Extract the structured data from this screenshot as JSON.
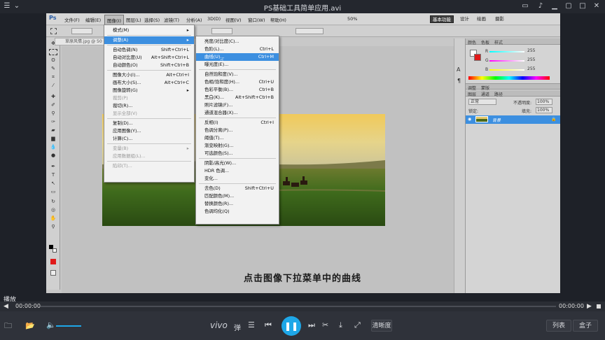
{
  "player": {
    "title": "PS基础工具简单应用.avi",
    "status_label": "播放",
    "time_current": "00:00:00",
    "time_total": "00:00:00",
    "brand": "vivo",
    "brand_suffix": "弹",
    "quality_label": "清晰度",
    "list_button": "列表",
    "box_button": "盒子",
    "volume_level": 0.6
  },
  "ps": {
    "menus": [
      "文件(F)",
      "编辑(E)",
      "图像(I)",
      "图层(L)",
      "选择(S)",
      "滤镜(T)",
      "分析(A)",
      "3D(D)",
      "视图(V)",
      "窗口(W)",
      "帮助(H)"
    ],
    "zoom": "50%",
    "workspace_tabs": [
      "基本功能",
      "设计",
      "绘画",
      "摄影"
    ],
    "doc_tab": "草原风情.jpg @ 50",
    "image_menu": [
      {
        "label": "模式(M)",
        "shortcut": "",
        "arrow": true
      },
      {
        "sep": true
      },
      {
        "label": "调整(A)",
        "shortcut": "",
        "arrow": true,
        "highlight": true
      },
      {
        "sep": true
      },
      {
        "label": "自动色调(N)",
        "shortcut": "Shift+Ctrl+L"
      },
      {
        "label": "自动对比度(U)",
        "shortcut": "Alt+Shift+Ctrl+L"
      },
      {
        "label": "自动颜色(O)",
        "shortcut": "Shift+Ctrl+B"
      },
      {
        "sep": true
      },
      {
        "label": "图像大小(I)...",
        "shortcut": "Alt+Ctrl+I"
      },
      {
        "label": "画布大小(S)...",
        "shortcut": "Alt+Ctrl+C"
      },
      {
        "label": "图像旋转(G)",
        "shortcut": "",
        "arrow": true
      },
      {
        "label": "裁剪(P)",
        "shortcut": "",
        "disabled": true
      },
      {
        "label": "裁切(R)...",
        "shortcut": ""
      },
      {
        "label": "显示全部(V)",
        "shortcut": "",
        "disabled": true
      },
      {
        "sep": true
      },
      {
        "label": "复制(D)...",
        "shortcut": ""
      },
      {
        "label": "应用图像(Y)...",
        "shortcut": ""
      },
      {
        "label": "计算(C)...",
        "shortcut": ""
      },
      {
        "sep": true
      },
      {
        "label": "变量(B)",
        "shortcut": "",
        "disabled": true,
        "arrow": true
      },
      {
        "label": "应用数据组(L)...",
        "shortcut": "",
        "disabled": true
      },
      {
        "sep": true
      },
      {
        "label": "陷印(T)...",
        "shortcut": "",
        "disabled": true
      }
    ],
    "adjust_menu": [
      {
        "label": "亮度/对比度(C)...",
        "shortcut": ""
      },
      {
        "label": "色阶(L)...",
        "shortcut": "Ctrl+L"
      },
      {
        "label": "曲线(U)...",
        "shortcut": "Ctrl+M",
        "highlight": true
      },
      {
        "label": "曝光度(E)...",
        "shortcut": ""
      },
      {
        "sep": true
      },
      {
        "label": "自然饱和度(V)...",
        "shortcut": ""
      },
      {
        "label": "色相/饱和度(H)...",
        "shortcut": "Ctrl+U"
      },
      {
        "label": "色彩平衡(B)...",
        "shortcut": "Ctrl+B"
      },
      {
        "label": "黑白(K)...",
        "shortcut": "Alt+Shift+Ctrl+B"
      },
      {
        "label": "照片滤镜(F)...",
        "shortcut": ""
      },
      {
        "label": "通道混合器(X)...",
        "shortcut": ""
      },
      {
        "sep": true
      },
      {
        "label": "反相(I)",
        "shortcut": "Ctrl+I"
      },
      {
        "label": "色调分离(P)...",
        "shortcut": ""
      },
      {
        "label": "阈值(T)...",
        "shortcut": ""
      },
      {
        "label": "渐变映射(G)...",
        "shortcut": ""
      },
      {
        "label": "可选颜色(S)...",
        "shortcut": ""
      },
      {
        "sep": true
      },
      {
        "label": "阴影/高光(W)...",
        "shortcut": ""
      },
      {
        "label": "HDR 色调...",
        "shortcut": ""
      },
      {
        "label": "变化...",
        "shortcut": ""
      },
      {
        "sep": true
      },
      {
        "label": "去色(D)",
        "shortcut": "Shift+Ctrl+U"
      },
      {
        "label": "匹配颜色(M)...",
        "shortcut": ""
      },
      {
        "label": "替换颜色(R)...",
        "shortcut": ""
      },
      {
        "label": "色调均化(Q)",
        "shortcut": ""
      }
    ],
    "panel_tabs_top": [
      "颜色",
      "色板",
      "样式"
    ],
    "rgb": {
      "R": "255",
      "G": "255",
      "B": "255"
    },
    "panel_tabs_mid": [
      "调整",
      "蒙版"
    ],
    "panel_tabs_layers": [
      "图层",
      "通道",
      "路径"
    ],
    "blend_mode": "正常",
    "opacity_label": "不透明度:",
    "opacity_value": "100%",
    "fill_label": "填充:",
    "fill_value": "100%",
    "lock_label": "锁定:",
    "layer_name": "背景"
  },
  "subtitle": "点击图像下拉菜单中的曲线",
  "colors": {
    "highlight": "#3c8fe0",
    "accent": "#1ea7e8"
  }
}
